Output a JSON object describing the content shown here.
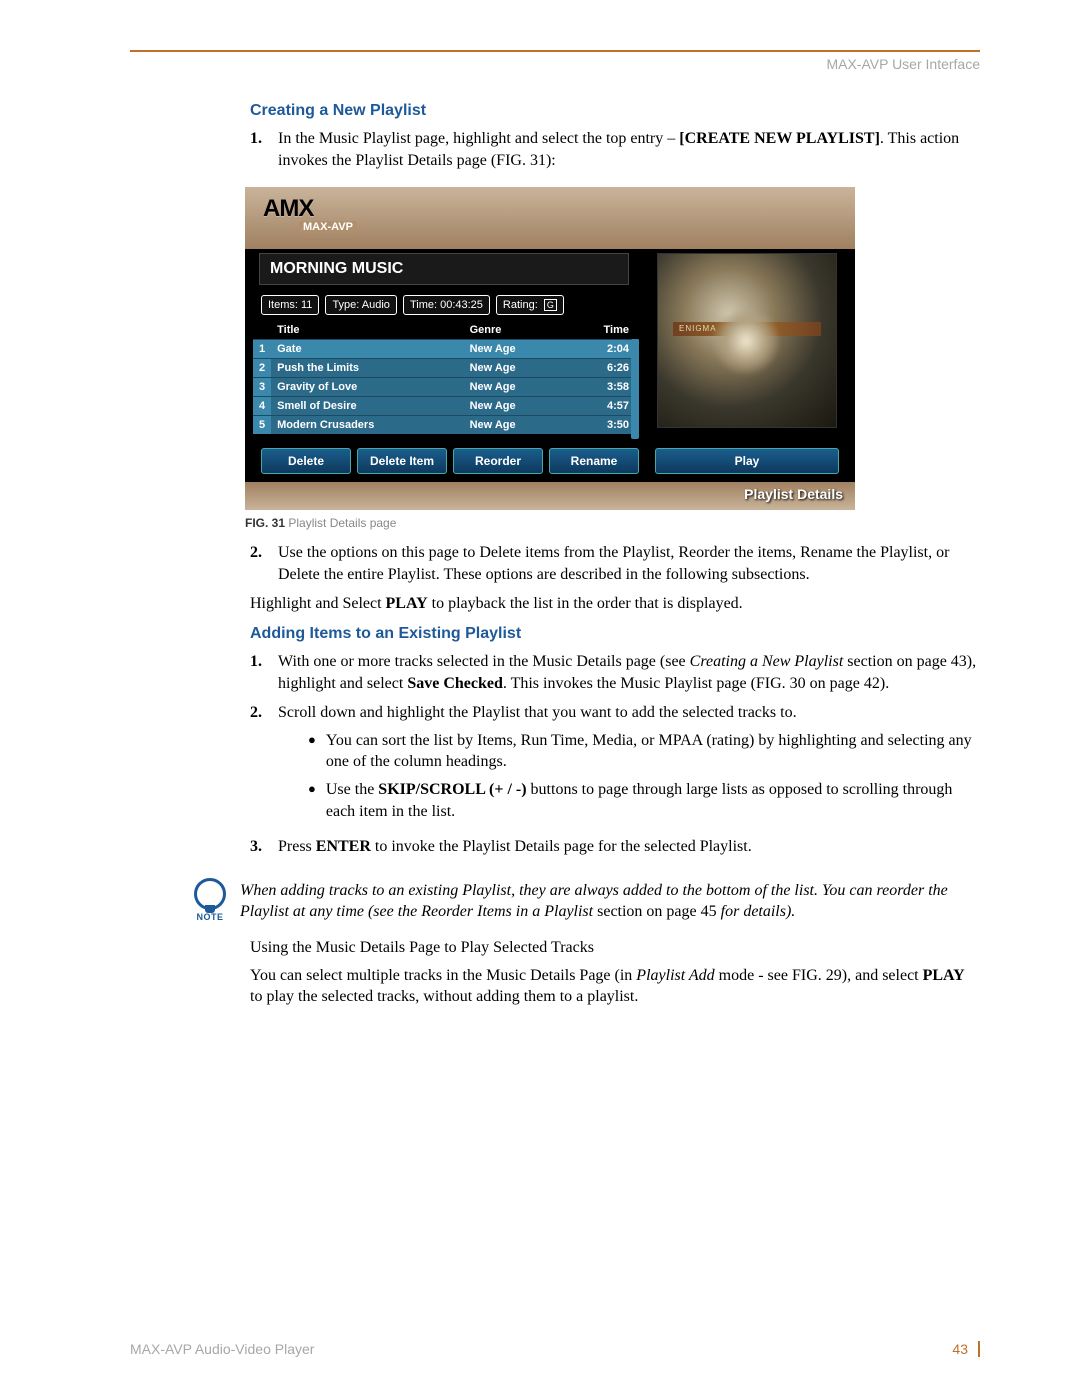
{
  "header": {
    "text": "MAX-AVP User Interface"
  },
  "section1": {
    "title": "Creating a New Playlist",
    "steps": [
      {
        "num": "1.",
        "pre": "In the Music Playlist page, highlight and select the top entry – ",
        "bold": "[CREATE NEW PLAYLIST]",
        "post": ". This action invokes the Playlist Details page (FIG. 31):"
      },
      {
        "num": "2.",
        "pre": "Use the options on this page to Delete items from the Playlist, Reorder the items, Rename the Playlist, or Delete the entire Playlist. These options are described in the following subsections."
      }
    ],
    "play_line": {
      "pre": "Highlight and Select ",
      "bold": "PLAY",
      "post": " to playback the list in the order that is displayed."
    }
  },
  "figure": {
    "logo": "AMX",
    "logo_sub": "MAX-AVP",
    "playlist_name": "MORNING MUSIC",
    "info": {
      "items": "Items:  11",
      "type": "Type:  Audio",
      "time": "Time:  00:43:25",
      "rating": "Rating:",
      "rating_badge": "G"
    },
    "cover_label": "ENIGMA",
    "columns": {
      "title": "Title",
      "genre": "Genre",
      "time": "Time"
    },
    "tracks": [
      {
        "n": "1",
        "title": "Gate",
        "genre": "New Age",
        "time": "2:04",
        "selected": true
      },
      {
        "n": "2",
        "title": "Push the Limits",
        "genre": "New Age",
        "time": "6:26"
      },
      {
        "n": "3",
        "title": "Gravity of Love",
        "genre": "New Age",
        "time": "3:58"
      },
      {
        "n": "4",
        "title": "Smell of Desire",
        "genre": "New Age",
        "time": "4:57"
      },
      {
        "n": "5",
        "title": "Modern Crusaders",
        "genre": "New Age",
        "time": "3:50"
      }
    ],
    "buttons": {
      "delete": "Delete",
      "delete_item": "Delete Item",
      "reorder": "Reorder",
      "rename": "Rename",
      "play": "Play"
    },
    "page_label": "Playlist Details",
    "caption_bold": "FIG. 31",
    "caption_rest": "  Playlist Details page"
  },
  "section2": {
    "title": "Adding Items to an Existing Playlist",
    "steps": [
      {
        "num": "1.",
        "pre": "With one or more tracks selected in the Music Details page (see ",
        "it": "Creating a New Playlist",
        "mid": " section on page 43), highlight and select ",
        "bold": "Save Checked",
        "post": ". This invokes the Music Playlist page (FIG. 30 on page 42)."
      },
      {
        "num": "2.",
        "pre": "Scroll down and highlight the Playlist that you want to add the selected tracks to."
      },
      {
        "num": "3.",
        "pre": "Press ",
        "bold": "ENTER",
        "post": " to invoke the Playlist Details page for the selected Playlist."
      }
    ],
    "bullets": [
      "You can sort the list by Items, Run Time, Media, or MPAA (rating) by highlighting and selecting any one of the column headings.",
      {
        "pre": "Use the ",
        "bold": "SKIP/SCROLL (+ / -)",
        "post": " buttons to page through large lists as opposed to scrolling through each item in the list."
      }
    ]
  },
  "note": {
    "label": "NOTE",
    "line1": "When adding tracks to an existing Playlist, they are always added to the bottom of the list. You can reorder the Playlist at any time (see the Reorder Items in a Playlist",
    "line2_plain": " section on page 45 ",
    "line2_it": "for details)."
  },
  "closing": {
    "heading": "Using the Music Details Page to Play Selected Tracks",
    "p1_pre": "You can select multiple tracks in the Music Details Page (in ",
    "p1_it": "Playlist Add",
    "p1_mid": " mode - see FIG. 29), and select ",
    "p1_bold": "PLAY",
    "p1_post": " to play the selected tracks, without adding them to a playlist."
  },
  "footer": {
    "left": "MAX-AVP Audio-Video Player",
    "right": "43"
  }
}
